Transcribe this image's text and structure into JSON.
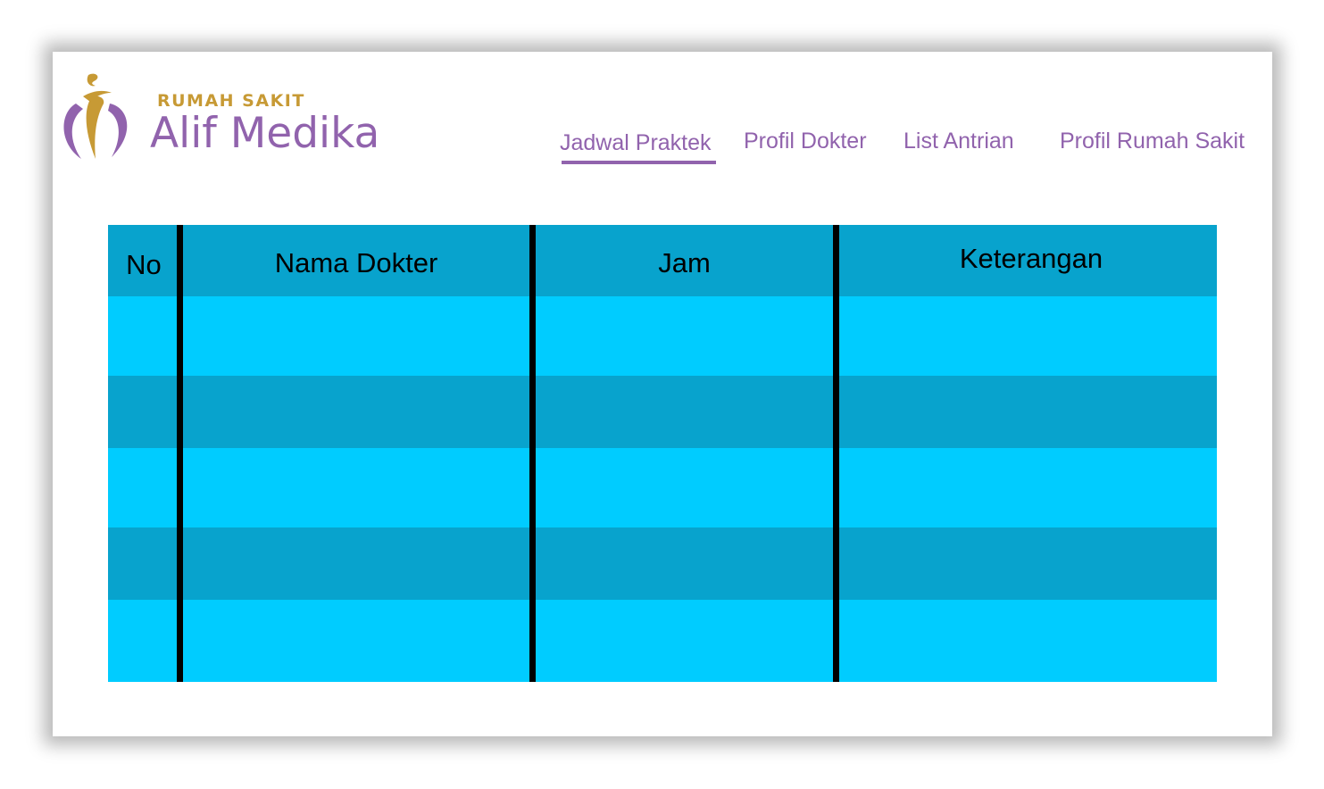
{
  "brand": {
    "subtitle": "RUMAH SAKIT",
    "name": "Alif Medika",
    "logo_icon": "alif-medika-logo-icon",
    "colors": {
      "purple": "#9163ad",
      "gold": "#c79a35"
    }
  },
  "nav": {
    "items": [
      {
        "label": "Jadwal Praktek",
        "active": true
      },
      {
        "label": "Profil Dokter",
        "active": false
      },
      {
        "label": "List Antrian",
        "active": false
      },
      {
        "label": "Profil Rumah Sakit",
        "active": false
      }
    ]
  },
  "table": {
    "headers": [
      "No",
      "Nama Dokter",
      "Jam",
      "Keterangan"
    ],
    "rows": [
      [
        "",
        "",
        "",
        ""
      ],
      [
        "",
        "",
        "",
        ""
      ],
      [
        "",
        "",
        "",
        ""
      ],
      [
        "",
        "",
        "",
        ""
      ],
      [
        "",
        "",
        "",
        ""
      ]
    ],
    "colors": {
      "header": "#08a3cd",
      "row_light": "#00ccff",
      "row_dark": "#08a3cd",
      "divider": "#000000"
    }
  }
}
